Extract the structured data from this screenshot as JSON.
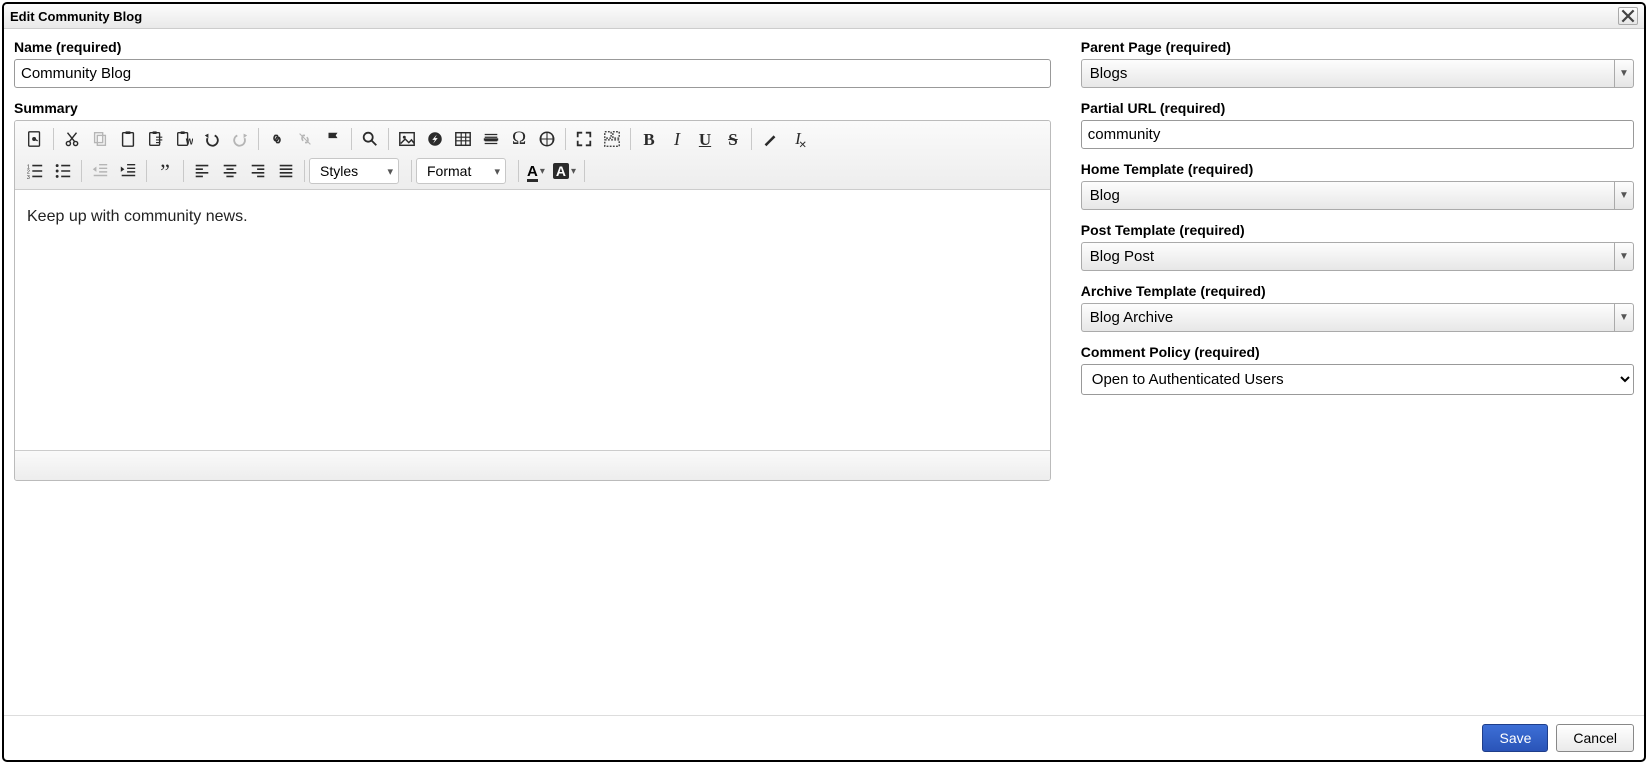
{
  "dialog": {
    "title": "Edit Community Blog"
  },
  "left": {
    "name_label": "Name (required)",
    "name_value": "Community Blog",
    "summary_label": "Summary",
    "summary_body": "Keep up with community news."
  },
  "right": {
    "parent_page_label": "Parent Page (required)",
    "parent_page_value": "Blogs",
    "partial_url_label": "Partial URL (required)",
    "partial_url_value": "community",
    "home_template_label": "Home Template (required)",
    "home_template_value": "Blog",
    "post_template_label": "Post Template (required)",
    "post_template_value": "Blog Post",
    "archive_template_label": "Archive Template (required)",
    "archive_template_value": "Blog Archive",
    "comment_policy_label": "Comment Policy (required)",
    "comment_policy_value": "Open to Authenticated Users"
  },
  "toolbar": {
    "styles_label": "Styles",
    "format_label": "Format"
  },
  "footer": {
    "save": "Save",
    "cancel": "Cancel"
  }
}
